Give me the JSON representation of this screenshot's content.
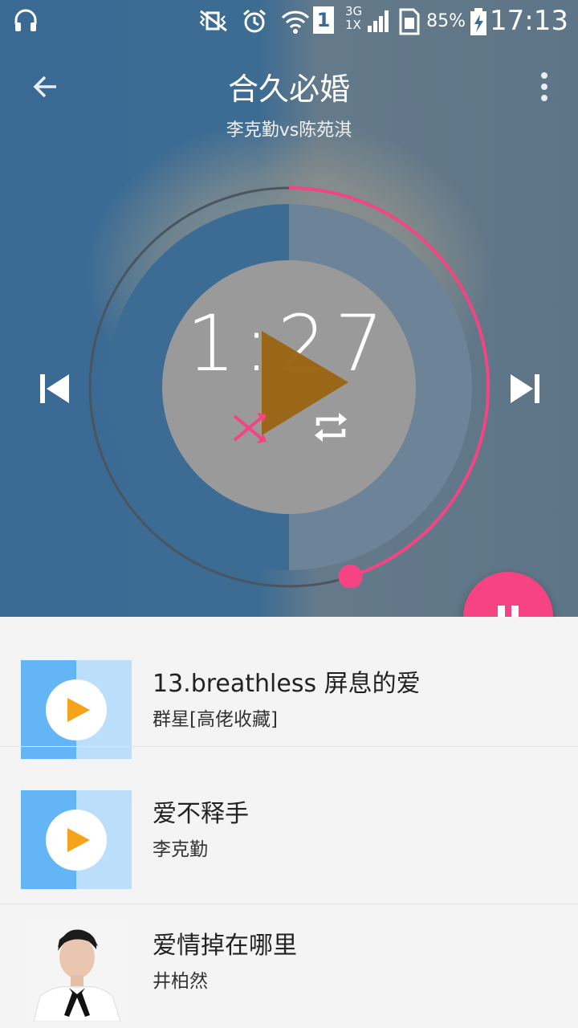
{
  "status_bar": {
    "battery": "85%",
    "time": "17:13",
    "network": "3G 1X",
    "sim": "1"
  },
  "header": {
    "title": "合久必婚",
    "subtitle": "李克勤vs陈苑淇"
  },
  "player": {
    "elapsed": "1:27",
    "progress": 0.45,
    "accent_color": "#f54481",
    "play_color": "#9a6515"
  },
  "playlist": [
    {
      "title": "13.breathless 屏息的爱",
      "artist": "群星[高佬收藏]",
      "thumb": "play-icon"
    },
    {
      "title": "爱不释手",
      "artist": "李克勤",
      "thumb": "play-icon"
    },
    {
      "title": "爱情掉在哪里",
      "artist": "井柏然",
      "thumb": "album-photo"
    }
  ]
}
